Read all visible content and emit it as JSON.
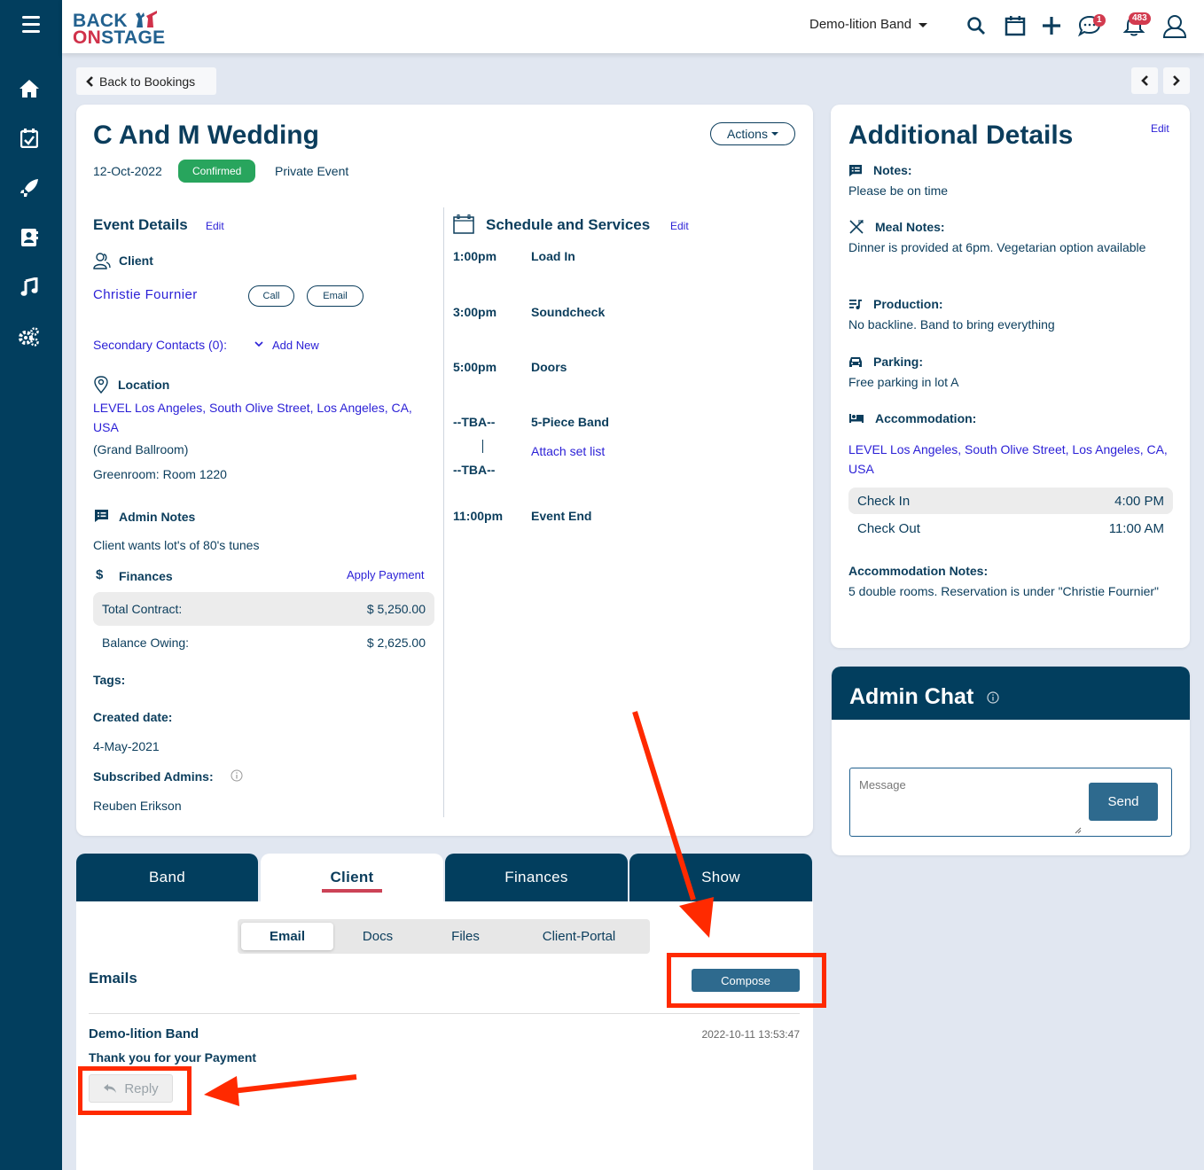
{
  "app": {
    "logo_line1": "BACK",
    "logo_line2_a": "ON",
    "logo_line2_b": "STAGE"
  },
  "sidebar": {
    "items": [
      {
        "icon": "home-icon"
      },
      {
        "icon": "calendar-check-icon"
      },
      {
        "icon": "rocket-icon"
      },
      {
        "icon": "contacts-book-icon"
      },
      {
        "icon": "music-note-icon"
      },
      {
        "icon": "gears-icon"
      }
    ]
  },
  "header": {
    "band_name": "Demo-lition Band",
    "chat_badge": "1",
    "notification_badge": "483"
  },
  "nav": {
    "back_label": "Back to Bookings"
  },
  "event": {
    "title": "C And M Wedding",
    "date": "12-Oct-2022",
    "status": "Confirmed",
    "type": "Private Event",
    "actions_label": "Actions",
    "details_heading": "Event Details",
    "edit_label": "Edit",
    "client_heading": "Client",
    "client_name": "Christie Fournier",
    "call_label": "Call",
    "email_label": "Email",
    "secondary_contacts": "Secondary Contacts (0):",
    "add_new": "Add New",
    "location_heading": "Location",
    "location_address": "LEVEL Los Angeles, South Olive Street, Los Angeles, CA, USA",
    "location_room": "(Grand Ballroom)",
    "greenroom": "Greenroom: Room 1220",
    "admin_notes_heading": "Admin Notes",
    "admin_notes": "Client wants lot's of 80's tunes",
    "finances_heading": "Finances",
    "apply_payment": "Apply Payment",
    "finances": [
      {
        "label": "Total Contract:",
        "value": "$ 5,250.00"
      },
      {
        "label": "Balance Owing:",
        "value": "$ 2,625.00"
      }
    ],
    "tags_label": "Tags:",
    "created_label": "Created date:",
    "created_value": "4-May-2021",
    "subscribed_label": "Subscribed Admins:",
    "subscribed_value": "Reuben Erikson"
  },
  "schedule": {
    "heading": "Schedule and Services",
    "edit_label": "Edit",
    "items": [
      {
        "time": "1:00pm",
        "name": "Load In"
      },
      {
        "time": "3:00pm",
        "name": "Soundcheck"
      },
      {
        "time": "5:00pm",
        "name": "Doors"
      },
      {
        "time": "--TBA--",
        "end_time": "--TBA--",
        "name": "5-Piece Band",
        "link": "Attach set list"
      },
      {
        "time": "11:00pm",
        "name": "Event End"
      }
    ]
  },
  "additional": {
    "heading": "Additional Details",
    "edit_label": "Edit",
    "notes_label": "Notes:",
    "notes": "Please be on time",
    "meal_label": "Meal Notes:",
    "meal": "Dinner is provided at 6pm. Vegetarian option available",
    "production_label": "Production:",
    "production": "No backline. Band to bring everything",
    "parking_label": "Parking:",
    "parking": "Free parking in lot A",
    "accommodation_label": "Accommodation:",
    "accommodation_address": "LEVEL Los Angeles, South Olive Street, Los Angeles, CA, USA",
    "check_rows": [
      {
        "label": "Check In",
        "value": "4:00 PM"
      },
      {
        "label": "Check Out",
        "value": "11:00 AM"
      }
    ],
    "acc_notes_label": "Accommodation Notes:",
    "acc_notes": "5 double rooms. Reservation is under \"Christie Fournier\""
  },
  "admin_chat": {
    "heading": "Admin Chat",
    "message_placeholder": "Message",
    "send_label": "Send"
  },
  "tabs": {
    "items": [
      "Band",
      "Client",
      "Finances",
      "Show"
    ],
    "active": "Client"
  },
  "client_tab": {
    "subtabs": [
      "Email",
      "Docs",
      "Files",
      "Client-Portal"
    ],
    "active_subtab": "Email",
    "emails_heading": "Emails",
    "compose_label": "Compose",
    "emails": [
      {
        "from": "Demo-lition Band",
        "timestamp": "2022-10-11 13:53:47",
        "subject": "Thank you for your Payment",
        "reply_label": "Reply"
      }
    ]
  },
  "colors": {
    "navy": "#023e5e",
    "link": "#2a1fd6",
    "confirmed": "#28a55d",
    "button": "#2e6a8e",
    "accent_underline": "#cc4256",
    "annotation": "#ff2a00"
  }
}
